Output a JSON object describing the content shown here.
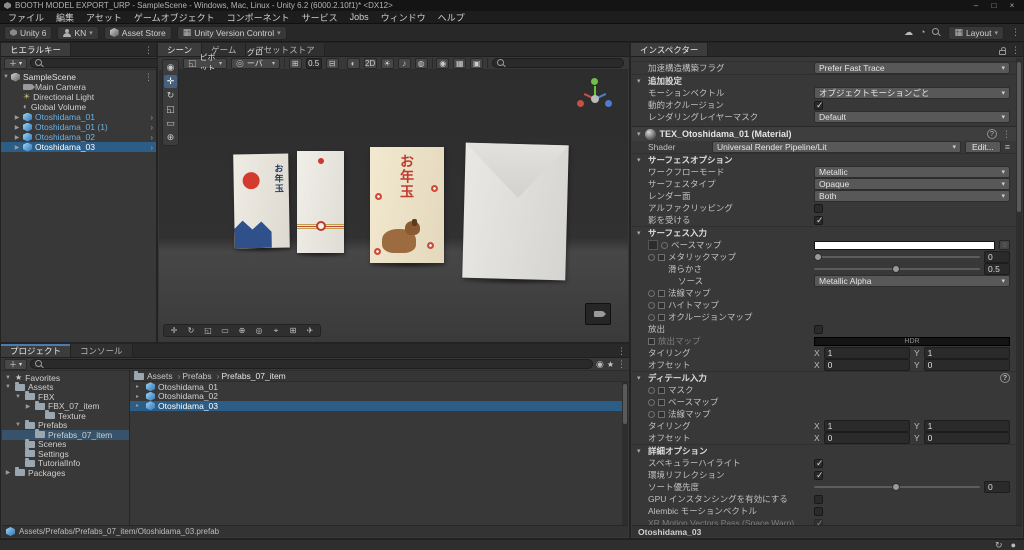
{
  "window": {
    "title": "BOOTH MODEL EXPORT_URP - SampleScene - Windows, Mac, Linux - Unity 6.2 (6000.2.10f1)* <DX12>",
    "minimize": "–",
    "maximize": "□",
    "close": "×"
  },
  "menu": {
    "items": [
      "ファイル",
      "編集",
      "アセット",
      "ゲームオブジェクト",
      "コンポーネント",
      "サービス",
      "Jobs",
      "ウィンドウ",
      "ヘルプ"
    ]
  },
  "toolbar": {
    "unity_badge": "Unity 6",
    "account": "KN",
    "asset_store": "Asset Store",
    "version_control": "Unity Version Control",
    "layout": "Layout"
  },
  "hierarchy": {
    "tab": "ヒエラルキー",
    "add": "＋",
    "scene_name": "SampleScene",
    "scene_arrow": "▼",
    "items": [
      {
        "label": "Main Camera",
        "arrow": ""
      },
      {
        "label": "Directional Light",
        "arrow": ""
      },
      {
        "label": "Global Volume",
        "arrow": ""
      },
      {
        "label": "Otoshidama_01",
        "arrow": "▶"
      },
      {
        "label": "Otoshidama_01 (1)",
        "arrow": "▶"
      },
      {
        "label": "Otoshidama_02",
        "arrow": "▶"
      },
      {
        "label": "Otoshidama_03",
        "arrow": "▶"
      }
    ]
  },
  "scene": {
    "tabs": {
      "scene": "シーン",
      "game": "ゲーム",
      "asset_store": "アセットストア"
    },
    "toolbar": {
      "pivot": "ピボット",
      "global": "グローバル",
      "snap": "0.5",
      "two_d": "2D"
    },
    "env1_text": "お年玉",
    "env3_text": "お年玉"
  },
  "project": {
    "tab": "プロジェクト",
    "console_tab": "コンソール",
    "add": "＋",
    "favorites": "Favorites",
    "tree": [
      {
        "label": "Assets",
        "arrow": "▼"
      },
      {
        "label": "FBX",
        "arrow": "▼"
      },
      {
        "label": "FBX_07_item",
        "arrow": "▶"
      },
      {
        "label": "Texture",
        "arrow": ""
      },
      {
        "label": "Prefabs",
        "arrow": "▼"
      },
      {
        "label": "Prefabs_07_item",
        "arrow": ""
      },
      {
        "label": "Scenes",
        "arrow": ""
      },
      {
        "label": "Settings",
        "arrow": ""
      },
      {
        "label": "TutorialInfo",
        "arrow": ""
      },
      {
        "label": "Packages",
        "arrow": "▶"
      }
    ],
    "breadcrumb": {
      "a": "Assets",
      "b": "Prefabs",
      "c": "Prefabs_07_item"
    },
    "files": [
      {
        "name": "Otoshidama_01"
      },
      {
        "name": "Otoshidama_02"
      },
      {
        "name": "Otoshidama_03"
      }
    ],
    "status_path": "Assets/Prefabs/Prefabs_07_item/Otoshidama_03.prefab"
  },
  "inspector": {
    "tab": "インスペクター",
    "renderer": {
      "accel_label": "加速構造構築フラグ",
      "accel_value": "Prefer Fast Trace",
      "additional": "追加設定",
      "motion_label": "モーションベクトル",
      "motion_value": "オブジェクトモーションごと",
      "occlusion_label": "動的オクルージョン",
      "layer_label": "レンダリングレイヤーマスク",
      "layer_value": "Default"
    },
    "material": {
      "title": "TEX_Otoshidama_01 (Material)",
      "shader_label": "Shader",
      "shader_value": "Universal Render Pipeline/Lit",
      "edit": "Edit...",
      "surface_options_title": "サーフェスオプション",
      "workflow_label": "ワークフローモード",
      "workflow_value": "Metallic",
      "surface_label": "サーフェスタイプ",
      "surface_value": "Opaque",
      "face_label": "レンダー面",
      "face_value": "Both",
      "alpha_label": "アルファクリッピング",
      "shadow_label": "影を受ける",
      "surface_inputs_title": "サーフェス入力",
      "base_map": "ベースマップ",
      "metallic_map": "メタリックマップ",
      "metallic_value": "0",
      "smoothness": "滑らかさ",
      "smoothness_value": "0.5",
      "source_label": "ソース",
      "source_value": "Metallic Alpha",
      "normal_map": "法線マップ",
      "height_map": "ハイトマップ",
      "occlusion_map": "オクルージョンマップ",
      "emission": "放出",
      "emission_map": "放出マップ",
      "hdr": "HDR",
      "tiling": "タイリング",
      "offset": "オフセット",
      "x": "X",
      "y": "Y",
      "tiling_x": "1",
      "tiling_y": "1",
      "offset_x": "0",
      "offset_y": "0",
      "detail_title": "ディテール入力",
      "mask": "マスク",
      "detail_base": "ベースマップ",
      "detail_normal": "法線マップ",
      "d_tiling_x": "1",
      "d_tiling_y": "1",
      "d_offset_x": "0",
      "d_offset_y": "0",
      "advanced_title": "詳細オプション",
      "specular": "スペキュラーハイライト",
      "reflections": "環境リフレクション",
      "priority": "ソート優先度",
      "priority_value": "0",
      "gpu": "GPU インスタンシングを有効にする",
      "alembic": "Alembic モーションベクトル",
      "xr": "XR Motion Vectors Pass (Space Warp)"
    },
    "checks": {
      "occlusion": "cb on",
      "alpha": "cb",
      "shadow": "cb on",
      "emission": "cb",
      "specular": "cb on",
      "reflections": "cb on",
      "gpu": "cb",
      "alembic": "cb",
      "xr": "cb on dim"
    },
    "footer": "Otoshidama_03"
  }
}
